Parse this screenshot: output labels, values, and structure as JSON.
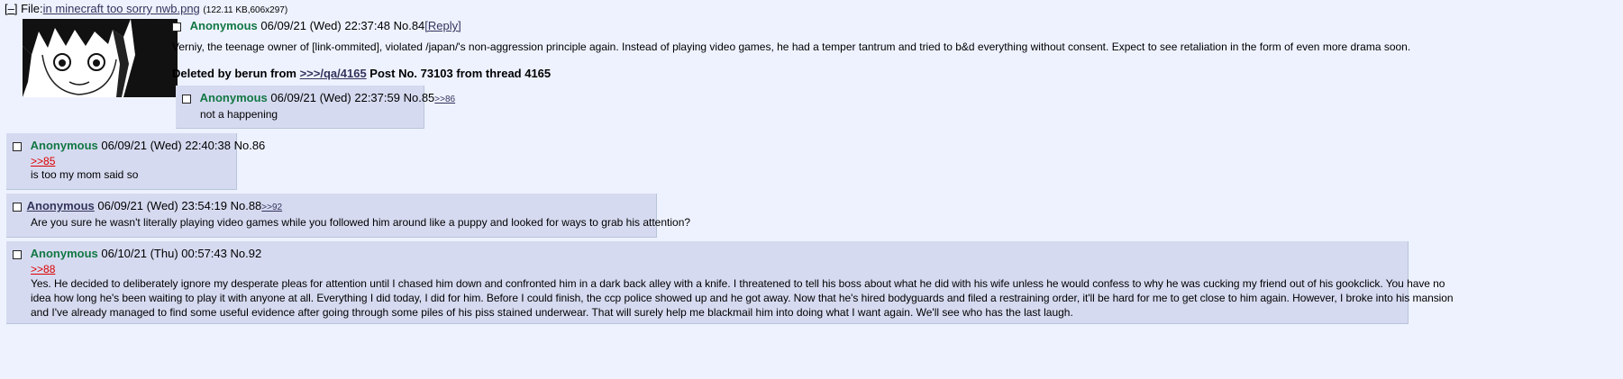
{
  "file": {
    "toggle": "[–]",
    "label": "File:",
    "filename": "in minecraft too sorry nwb.png",
    "meta": "(122.11 KB,606x297)"
  },
  "op": {
    "name": "Anonymous",
    "date": "06/09/21 (Wed) 22:37:48",
    "number": "No.84",
    "reply_link": "[Reply]",
    "text": "Verniy, the teenage owner of [link-ommited], violated /japan/'s non-aggression principle again. Instead of playing video games, he had a temper tantrum and tried to b&d everything without consent. Expect to see retaliation in the form of even more drama soon.",
    "deleted_prefix": "Deleted by berun from ",
    "deleted_link": ">>>/qa/4165",
    "deleted_suffix": " Post No. 73103 from thread 4165"
  },
  "posts": [
    {
      "name": "Anonymous",
      "date": "06/09/21 (Wed) 22:37:59",
      "number": "No.85",
      "backlink": ">>86",
      "text": "not a happening"
    },
    {
      "name": "Anonymous",
      "date": "06/09/21 (Wed) 22:40:38",
      "number": "No.86",
      "quote": ">>85",
      "text": "is too my mom said so"
    },
    {
      "name": "Anonymous",
      "date": "06/09/21 (Wed) 23:54:19",
      "number": "No.88",
      "backlink": ">>92",
      "text": "Are you sure he wasn't literally playing video games while you followed him around like a puppy and looked for ways to grab his attention?"
    },
    {
      "name": "Anonymous",
      "date": "06/10/21 (Thu) 00:57:43",
      "number": "No.92",
      "quote": ">>88",
      "text_lines": [
        "Yes. He decided to deliberately ignore my desperate pleas for attention until I chased him down and confronted him in a dark back alley with a knife. I threatened to tell his boss about what he did with his wife unless he would confess to why he was cucking my friend out of his gookclick. You have no",
        "idea how long he's been waiting to play it with anyone at all. Everything I did today, I did for him. Before I could finish, the ccp police showed up and he got away. Now that he's hired bodyguards and filed a restraining order, it'll be hard for me to get close to him again. However, I broke into his mansion",
        "and I've already managed to find some useful evidence after going through some piles of his piss stained underwear. That will surely help me blackmail him into doing what I want again. We'll see who has the last laugh."
      ]
    }
  ]
}
